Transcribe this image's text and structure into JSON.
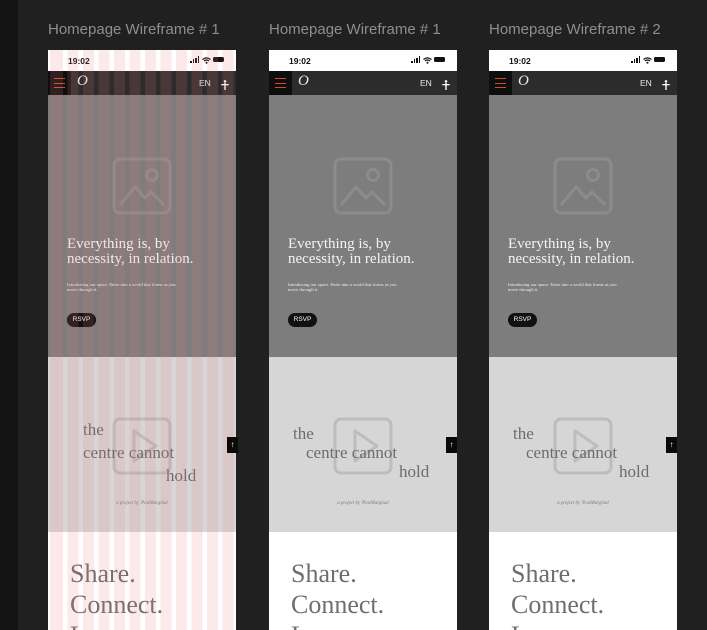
{
  "colors": {
    "canvas": "#202020",
    "hero_bg": "#7d7d7d",
    "project_bg": "#d6d6d6",
    "nav_bg": "#2c2c2c",
    "grid_overlay": "#e97878",
    "menu_accent": "#d04a2b"
  },
  "frames": [
    {
      "label": "Homepage Wireframe # 1",
      "status_time": "19:02",
      "logo": "O",
      "lang": "EN",
      "hero_title_1": "Everything is, by",
      "hero_title_2": "necessity, in relation.",
      "hero_sub_1": "Introducing our space. Enter into a world that forms as you",
      "hero_sub_2": "move through it.",
      "rsvp": "RSVP",
      "proj_1": "the",
      "proj_2": "centre cannot",
      "proj_3": "hold",
      "credit": "a project by 'PostMarginal",
      "arrow": "↑",
      "share_1": "Share.",
      "share_2": "Connect.",
      "share_3": "L",
      "grid_visible": true
    },
    {
      "label": "Homepage Wireframe # 1",
      "status_time": "19:02",
      "logo": "O",
      "lang": "EN",
      "hero_title_1": "Everything is, by",
      "hero_title_2": "necessity, in relation.",
      "hero_sub_1": "Introducing our space. Enter into a world that forms as you",
      "hero_sub_2": "move through it.",
      "rsvp": "RSVP",
      "proj_1": "the",
      "proj_2": "centre cannot",
      "proj_3": "hold",
      "credit": "a project by 'PostMarginal",
      "arrow": "↑",
      "share_1": "Share.",
      "share_2": "Connect.",
      "share_3": "L",
      "grid_visible": false
    },
    {
      "label": "Homepage Wireframe # 2",
      "status_time": "19:02",
      "logo": "O",
      "lang": "EN",
      "hero_title_1": "Everything is, by",
      "hero_title_2": "necessity, in relation.",
      "hero_sub_1": "Introducing our space. Enter into a world that forms as you",
      "hero_sub_2": "move through it.",
      "rsvp": "RSVP",
      "proj_1": "the",
      "proj_2": "centre cannot",
      "proj_3": "hold",
      "credit": "a project by 'PostMarginal",
      "arrow": "↑",
      "share_1": "Share.",
      "share_2": "Connect.",
      "share_3": "L",
      "grid_visible": false
    }
  ]
}
